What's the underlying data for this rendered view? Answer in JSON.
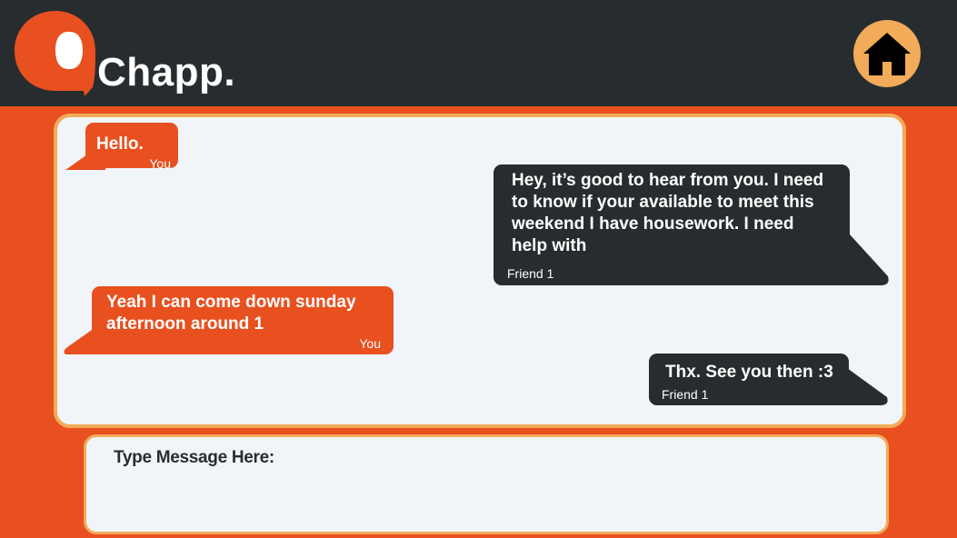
{
  "app": {
    "title": "Chapp.",
    "logo_icon": "chat-bubble-logo-icon",
    "home_icon": "home-icon"
  },
  "colors": {
    "primary": "#e9501f",
    "dark": "#272d2f",
    "accent": "#f2ab58",
    "panel": "#f1f5f9"
  },
  "messages": [
    {
      "text": "Hello.",
      "sender": "You"
    },
    {
      "text": "Hey, it’s good to hear from you. I need\nto know if your available to meet this\nweekend I have housework. I need\nhelp with",
      "sender": "Friend 1"
    },
    {
      "text": "Yeah I can come down sunday\nafternoon around 1",
      "sender": "You"
    },
    {
      "text": "Thx. See you then :3",
      "sender": "Friend 1"
    }
  ],
  "composer": {
    "placeholder": "Type Message Here:"
  }
}
